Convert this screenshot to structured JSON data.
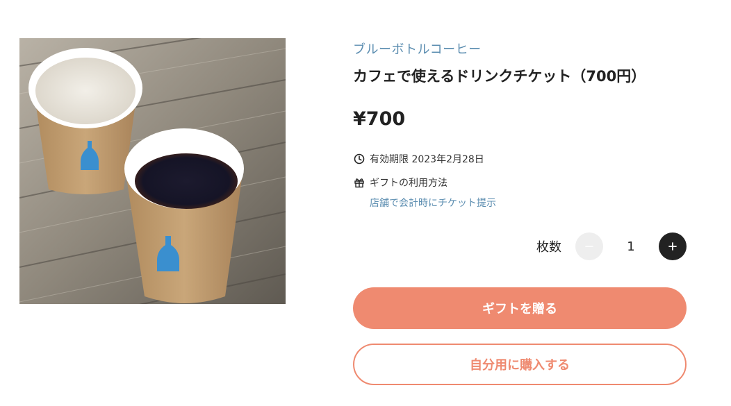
{
  "product": {
    "brand": "ブルーボトルコーヒー",
    "title": "カフェで使えるドリンクチケット（700円）",
    "price": "¥700",
    "image_icon": "coffee-cups-photo"
  },
  "expiry": {
    "icon": "clock-icon",
    "label": "有効期限 2023年2月28日"
  },
  "usage": {
    "icon": "gift-icon",
    "label": "ギフトの利用方法",
    "detail": "店舗で会計時にチケット提示"
  },
  "quantity": {
    "label": "枚数",
    "value": "1",
    "minus_icon": "minus-icon",
    "plus_icon": "plus-icon"
  },
  "actions": {
    "gift_label": "ギフトを贈る",
    "buy_label": "自分用に購入する"
  },
  "colors": {
    "accent": "#ef8a70",
    "link": "#5b8db0",
    "text": "#222222"
  }
}
